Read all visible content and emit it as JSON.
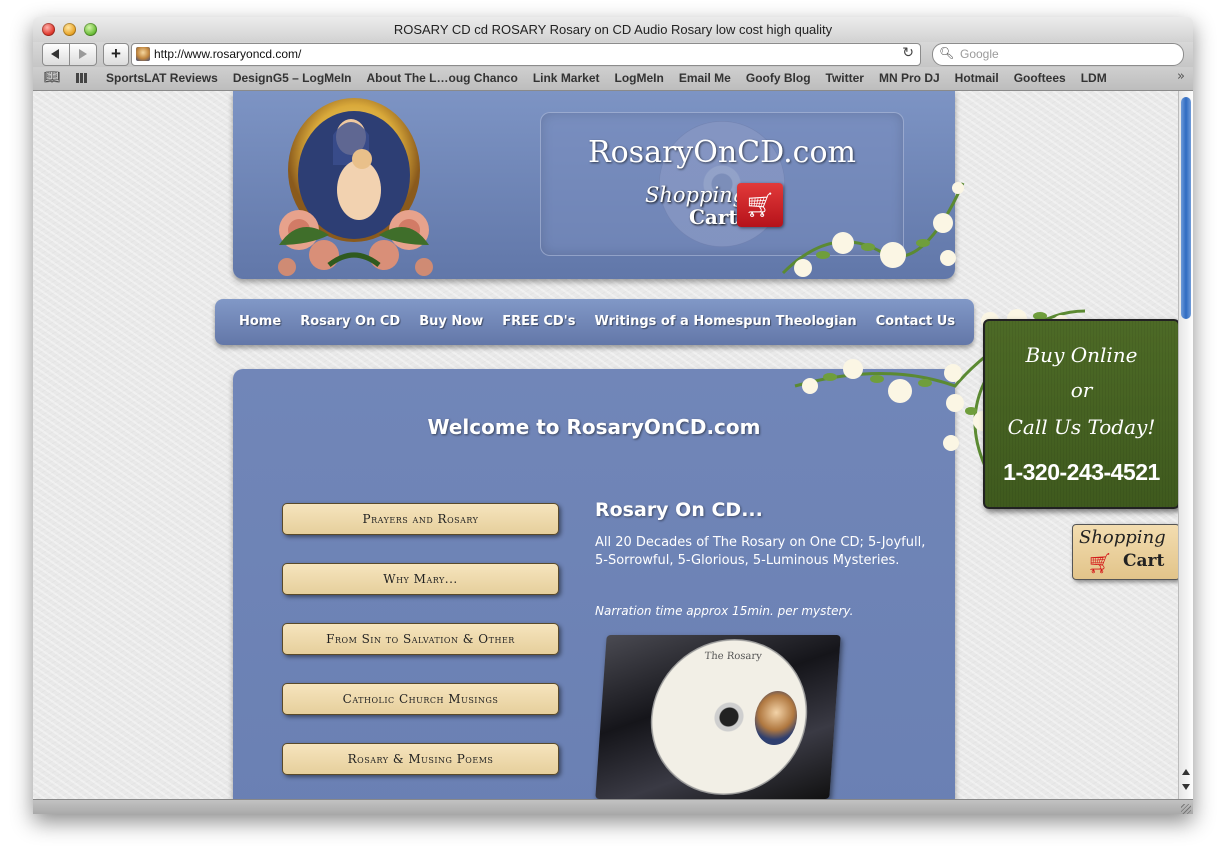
{
  "window": {
    "title": "ROSARY CD  cd ROSARY Rosary on CD Audio Rosary low cost high quality"
  },
  "toolbar": {
    "add_label": "+",
    "url": "http://www.rosaryoncd.com/",
    "search_placeholder": "Google"
  },
  "bookmarks": [
    "SportsLAT Reviews",
    "DesignG5 – LogMeIn",
    "About The L…oug Chanco",
    "Link Market",
    "LogMeIn",
    "Email Me",
    "Goofy Blog",
    "Twitter",
    "MN Pro DJ",
    "Hotmail",
    "Gooftees",
    "LDM"
  ],
  "header": {
    "logo_text": "RosaryOnCD.com",
    "logo_shopping": "Shopping",
    "logo_cart": "Cart"
  },
  "nav": [
    "Home",
    "Rosary On CD",
    "Buy Now",
    "FREE CD's",
    "Writings of a Homespun Theologian",
    "Contact Us"
  ],
  "main": {
    "welcome": "Welcome to RosaryOnCD.com",
    "menu_buttons": [
      "Prayers and Rosary",
      "Why Mary...",
      "From Sin to Salvation & Other",
      "Catholic Church Musings",
      "Rosary & Musing Poems"
    ],
    "product_title": "Rosary On CD...",
    "product_desc": "All 20 Decades of The Rosary on One CD; 5-Joyfull, 5-Sorrowful, 5-Glorious, 5-Luminous Mysteries.",
    "product_note": "Narration time approx 15min. per mystery.",
    "cd_label": "The Rosary"
  },
  "sidebar": {
    "buy_line1": "Buy Online",
    "buy_line2": "or",
    "buy_line3": "Call Us Today!",
    "phone": "1-320-243-4521",
    "cart_shopping": "Shopping",
    "cart_cart": "Cart"
  },
  "colors": {
    "panel_blue": "#6a80b3",
    "button_tan": "#f0dcae",
    "buy_green": "#46621f",
    "cart_red": "#d41a1a"
  }
}
